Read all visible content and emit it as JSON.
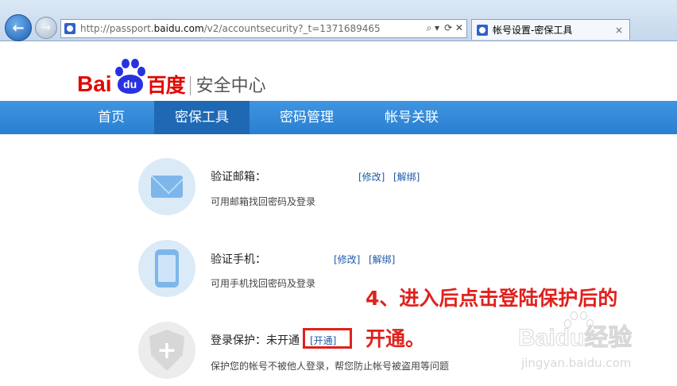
{
  "browser": {
    "url_prefix": "http://passport.",
    "url_domain": "baidu.com",
    "url_path": "/v2/accountsecurity?_t=1371689465",
    "tab_title": "帐号设置-密保工具",
    "tab_close": "×",
    "back_glyph": "←",
    "forward_glyph": "→",
    "addr_search_glyph": "⌕ ▾",
    "addr_refresh_glyph": "⟳ ✕"
  },
  "logo": {
    "bai": "Bai",
    "du": "du",
    "cn": "百度",
    "sub": "安全中心"
  },
  "nav": {
    "items": [
      "首页",
      "密保工具",
      "密码管理",
      "帐号关联"
    ],
    "active": "密保工具"
  },
  "items": {
    "email": {
      "title": "验证邮箱：",
      "desc": "可用邮箱找回密码及登录",
      "links": [
        "[修改]",
        "[解绑]"
      ],
      "icon": "mail-icon"
    },
    "phone": {
      "title": "验证手机：",
      "desc": "可用手机找回密码及登录",
      "links": [
        "[修改]",
        "[解绑]"
      ],
      "icon": "phone-icon"
    },
    "protect": {
      "title": "登录保护：未开通",
      "desc": "保护您的帐号不被他人登录，帮您防止帐号被盗用等问题",
      "link": "[开通]",
      "icon": "shield-plus-icon"
    }
  },
  "annotation": {
    "line1": "4、进入后点击登陆保护后的",
    "line2": "开通。",
    "color": "#e0211c"
  },
  "watermark": {
    "logo": "Baidu经验",
    "site": "jingyan.baidu.com"
  },
  "colors": {
    "nav_bg": "#2a7fd0",
    "nav_active": "#1f69b4",
    "brand_red": "#e10602",
    "brand_blue": "#2932e1",
    "link": "#1c5aa8"
  }
}
